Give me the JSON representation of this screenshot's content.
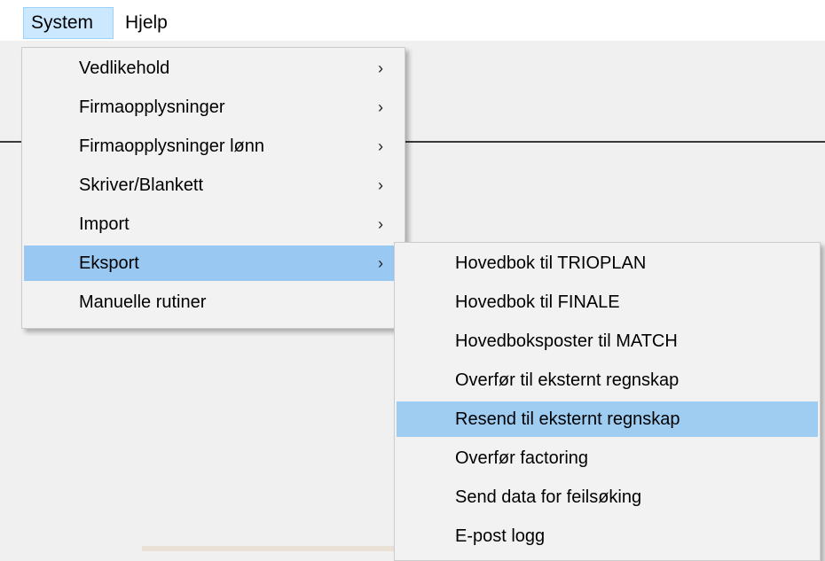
{
  "menubar": {
    "items": [
      {
        "label": "System"
      },
      {
        "label": "Hjelp"
      }
    ]
  },
  "system_menu": {
    "items": [
      {
        "label": "Vedlikehold",
        "arrow": "›"
      },
      {
        "label": "Firmaopplysninger",
        "arrow": "›"
      },
      {
        "label": "Firmaopplysninger lønn",
        "arrow": "›"
      },
      {
        "label": "Skriver/Blankett",
        "arrow": "›"
      },
      {
        "label": "Import",
        "arrow": "›"
      },
      {
        "label": "Eksport",
        "arrow": "›"
      },
      {
        "label": "Manuelle rutiner"
      }
    ]
  },
  "eksport_menu": {
    "items": [
      {
        "label": "Hovedbok til TRIOPLAN"
      },
      {
        "label": "Hovedbok til FINALE"
      },
      {
        "label": "Hovedboksposter til MATCH"
      },
      {
        "label": "Overfør til eksternt regnskap"
      },
      {
        "label": "Resend til eksternt regnskap"
      },
      {
        "label": "Overfør factoring"
      },
      {
        "label": "Send data for feilsøking"
      },
      {
        "label": "E-post logg"
      }
    ]
  },
  "colors": {
    "menubar_active": "#cce8ff",
    "menu_highlight": "#99c9f2",
    "menu_background": "#f2f2f2"
  }
}
